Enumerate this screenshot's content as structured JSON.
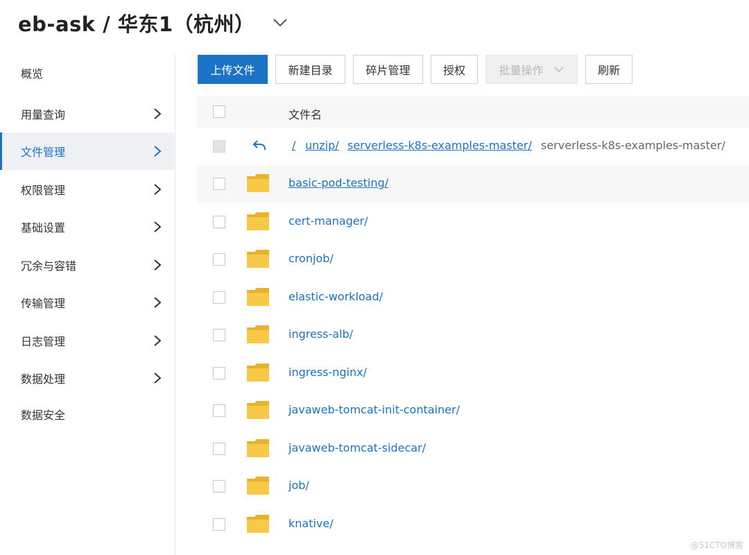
{
  "header": {
    "title": "eb-ask / 华东1（杭州）",
    "dropdown_icon": "chevron-down-icon"
  },
  "sidebar": {
    "items": [
      {
        "label": "概览",
        "has_arrow": false,
        "active": false
      },
      {
        "label": "用量查询",
        "has_arrow": true,
        "active": false
      },
      {
        "label": "文件管理",
        "has_arrow": true,
        "active": true
      },
      {
        "label": "权限管理",
        "has_arrow": true,
        "active": false
      },
      {
        "label": "基础设置",
        "has_arrow": true,
        "active": false
      },
      {
        "label": "冗余与容错",
        "has_arrow": true,
        "active": false
      },
      {
        "label": "传输管理",
        "has_arrow": true,
        "active": false
      },
      {
        "label": "日志管理",
        "has_arrow": true,
        "active": false
      },
      {
        "label": "数据处理",
        "has_arrow": true,
        "active": false
      },
      {
        "label": "数据安全",
        "has_arrow": false,
        "active": false
      }
    ]
  },
  "toolbar": {
    "upload": "上传文件",
    "new_dir": "新建目录",
    "fragments": "碎片管理",
    "authorize": "授权",
    "batch": "批量操作",
    "refresh": "刷新"
  },
  "table": {
    "header_name": "文件名"
  },
  "breadcrumb": {
    "links": [
      "/",
      "unzip/",
      "serverless-k8s-examples-master/"
    ],
    "current": "serverless-k8s-examples-master/"
  },
  "files": [
    "basic-pod-testing/",
    "cert-manager/",
    "cronjob/",
    "elastic-workload/",
    "ingress-alb/",
    "ingress-nginx/",
    "javaweb-tomcat-init-container/",
    "javaweb-tomcat-sidecar/",
    "job/",
    "knative/"
  ],
  "watermark": "@51CTO博客",
  "colors": {
    "accent": "#1a73c4",
    "folder": "#f7c948",
    "folder_back": "#e9b22c"
  }
}
